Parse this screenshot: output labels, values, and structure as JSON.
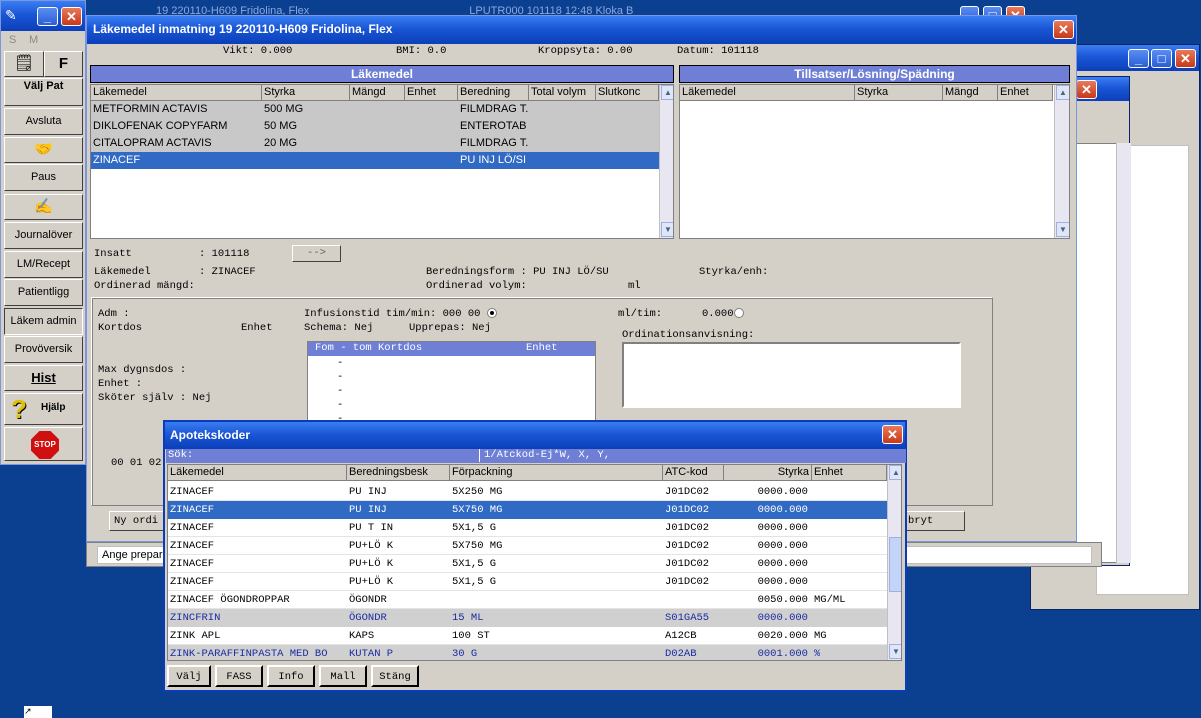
{
  "bg_titles": {
    "back1": "19 220110-H609 Fridolina, Flex",
    "back2": "LPUTR000 101118 12:48 Kloka B"
  },
  "sidebar": {
    "tl": "S",
    "tm": "M",
    "items": [
      {
        "name": "valj-pat",
        "label": "Välj Pat",
        "icon": "notepad-icon"
      },
      {
        "name": "avsluta",
        "label": "Avsluta"
      },
      {
        "name": "paus",
        "label": "Paus",
        "icon": "handshake-icon"
      },
      {
        "name": "journal",
        "label": "Journalöver",
        "icon": "journal-pen-icon"
      },
      {
        "name": "lm-recept",
        "label": "LM/Recept"
      },
      {
        "name": "patientligg",
        "label": "Patientligg"
      },
      {
        "name": "lakem-admin",
        "label": "Läkem admin"
      },
      {
        "name": "provoversikt",
        "label": "Provöversik"
      },
      {
        "name": "hist",
        "label": "Hist"
      },
      {
        "name": "hjalp",
        "label": "Hjälp",
        "icon": "question-icon"
      },
      {
        "name": "stop",
        "label": "STOP",
        "icon": "stop-sign-icon"
      }
    ],
    "f_label": "F"
  },
  "main": {
    "title": "Läkemedel inmatning  19 220110-H609  Fridolina, Flex",
    "info": {
      "vikt": "Vikt: 0.000",
      "bmi": "BMI: 0.0",
      "kroppsyta": "Kroppsyta: 0.00",
      "datum": "Datum: 101118"
    },
    "lakemedel_header": "Läkemedel",
    "columns": [
      "Läkemedel",
      "Styrka",
      "Mängd",
      "Enhet",
      "Beredning",
      "Total volym",
      "Slutkonc"
    ],
    "rows": [
      {
        "namn": "METFORMIN ACTAVIS",
        "styrka": "500 MG",
        "beredning": "FILMDRAG T."
      },
      {
        "namn": "DIKLOFENAK COPYFARM",
        "styrka": "50 MG",
        "beredning": "ENTEROTAB"
      },
      {
        "namn": "CITALOPRAM ACTAVIS",
        "styrka": "20 MG",
        "beredning": "FILMDRAG T."
      },
      {
        "namn": "ZINACEF",
        "styrka": "",
        "beredning": "PU INJ LÖ/SI"
      }
    ],
    "tillsatser_header": "Tillsatser/Lösning/Spädning",
    "tillsatser_columns": [
      "Läkemedel",
      "Styrka",
      "Mängd",
      "Enhet"
    ],
    "insatt_label": "Insatt",
    "insatt_value": ": 101118",
    "arrow_btn": "-->",
    "lakemedel_label": "Läkemedel",
    "lakemedel_value": ": ZINACEF",
    "beredningsform": "Beredningsform : PU INJ LÖ/SU",
    "styrka_enh": "Styrka/enh:",
    "ordinerad_mangd": "Ordinerad mängd:",
    "ordinerad_volym": "Ordinerad volym:",
    "volym_unit": "ml",
    "adm": "Adm      :",
    "kortdos": "Kortdos",
    "enhet": "Enhet",
    "infusionstid": "Infusionstid tim/min: 000 00",
    "mltim": "ml/tim:",
    "mltim_value": "0.000",
    "schema": "Schema: Nej",
    "upprepas": "Upprepas: Nej",
    "ordinationsanvisning": "Ordinationsanvisning:",
    "dos_header": "Fom - tom  Kortdos",
    "dos_header_enhet": "Enhet",
    "dos_dash": "-",
    "max_dygnsdos": "Max dygnsdos    :",
    "enhet2": "Enhet           :",
    "skoter_sjalv": "Sköter själv    : Nej",
    "time_partial": "00 01 02",
    "ny_ord": "Ny ordi",
    "avbryt": "bryt",
    "status": "Ange prepara"
  },
  "apotek": {
    "title": "Apotekskoder",
    "sok_label": "Sök:",
    "filter": "1/Atckod-Ej*W, X, Y,",
    "columns": [
      "Läkemedel",
      "Beredningsbesk",
      "Förpackning",
      "ATC-kod",
      "Styrka",
      "Enhet"
    ],
    "rows": [
      {
        "namn": "ZINACEF",
        "ber": "PU INJ",
        "forp": "5X250 MG",
        "atc": "J01DC02",
        "styrka": "0000.000",
        "enhet": "",
        "style": "normal"
      },
      {
        "namn": "ZINACEF",
        "ber": "PU INJ",
        "forp": "5X750 MG",
        "atc": "J01DC02",
        "styrka": "0000.000",
        "enhet": "",
        "style": "selected"
      },
      {
        "namn": "ZINACEF",
        "ber": "PU T IN",
        "forp": "5X1,5 G",
        "atc": "J01DC02",
        "styrka": "0000.000",
        "enhet": "",
        "style": "normal"
      },
      {
        "namn": "ZINACEF",
        "ber": "PU+LÖ K",
        "forp": "5X750 MG",
        "atc": "J01DC02",
        "styrka": "0000.000",
        "enhet": "",
        "style": "normal"
      },
      {
        "namn": "ZINACEF",
        "ber": "PU+LÖ K",
        "forp": "5X1,5 G",
        "atc": "J01DC02",
        "styrka": "0000.000",
        "enhet": "",
        "style": "normal"
      },
      {
        "namn": "ZINACEF",
        "ber": "PU+LÖ K",
        "forp": "5X1,5 G",
        "atc": "J01DC02",
        "styrka": "0000.000",
        "enhet": "",
        "style": "normal"
      },
      {
        "namn": "ZINACEF ÖGONDROPPAR",
        "ber": "ÖGONDR",
        "forp": "",
        "atc": "",
        "styrka": "0050.000",
        "enhet": "MG/ML",
        "style": "normal"
      },
      {
        "namn": "ZINCFRIN",
        "ber": "ÖGONDR",
        "forp": "15 ML",
        "atc": "S01GA55",
        "styrka": "0000.000",
        "enhet": "",
        "style": "gray"
      },
      {
        "namn": "ZINK APL",
        "ber": "KAPS",
        "forp": "100 ST",
        "atc": "A12CB",
        "styrka": "0020.000",
        "enhet": "MG",
        "style": "normal"
      },
      {
        "namn": "ZINK-PARAFFINPASTA MED BO",
        "ber": "KUTAN P",
        "forp": "30 G",
        "atc": "D02AB",
        "styrka": "0001.000",
        "enhet": "%",
        "style": "gray"
      }
    ],
    "buttons": [
      {
        "name": "valj-button",
        "label": "Välj"
      },
      {
        "name": "fass-button",
        "label": "FASS"
      },
      {
        "name": "info-button",
        "label": "Info"
      },
      {
        "name": "mall-button",
        "label": "Mall"
      },
      {
        "name": "stang-button",
        "label": "Stäng"
      }
    ]
  }
}
